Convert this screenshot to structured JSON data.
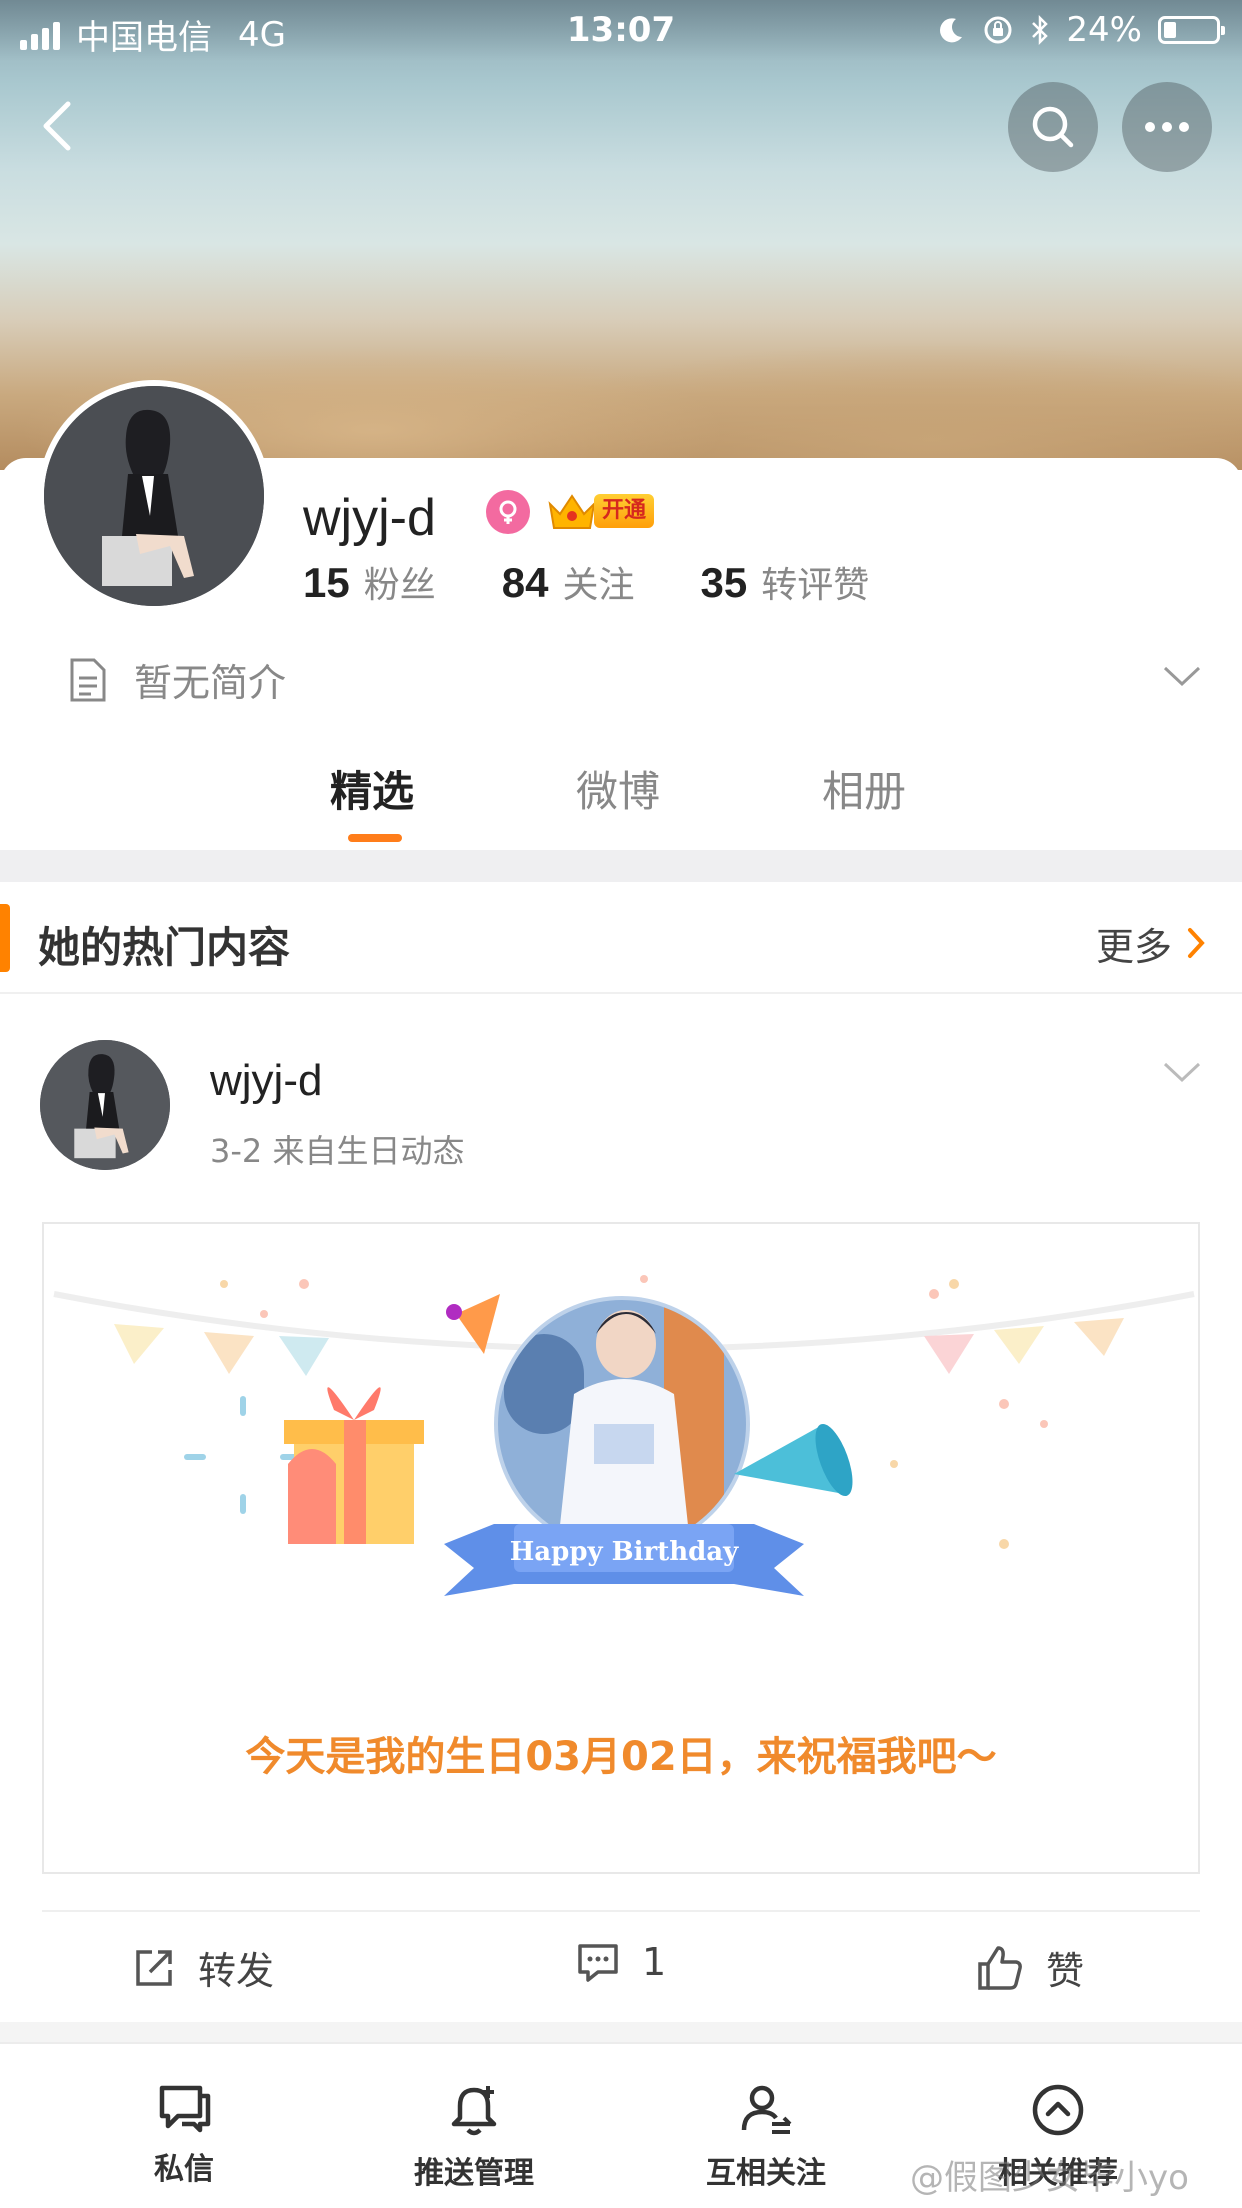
{
  "status_bar": {
    "carrier": "中国电信",
    "network": "4G",
    "time": "13:07",
    "battery": "24%"
  },
  "profile": {
    "username": "wjyj-d",
    "vip_label": "开通",
    "stats": [
      {
        "value": "15",
        "label": "粉丝"
      },
      {
        "value": "84",
        "label": "关注"
      },
      {
        "value": "35",
        "label": "转评赞"
      }
    ],
    "bio": "暂无简介"
  },
  "tabs": [
    {
      "label": "精选",
      "active": true
    },
    {
      "label": "微博",
      "active": false
    },
    {
      "label": "相册",
      "active": false
    }
  ],
  "section": {
    "title": "她的热门内容",
    "more": "更多"
  },
  "post": {
    "author": "wjyj-d",
    "meta": "3-2  来自生日动态",
    "card_banner": "Happy Birthday",
    "card_text": "今天是我的生日03月02日，来祝福我吧～",
    "actions": {
      "repost": "转发",
      "comment_count": "1",
      "like": "赞"
    }
  },
  "bottom_bar": [
    {
      "label": "私信",
      "icon": "message-icon"
    },
    {
      "label": "推送管理",
      "icon": "bell-plus-icon"
    },
    {
      "label": "互相关注",
      "icon": "mutual-follow-icon"
    },
    {
      "label": "相关推荐",
      "icon": "chevron-up-circle-icon"
    }
  ],
  "watermark": "@假图少女毕小yo",
  "colors": {
    "accent": "#ff8200",
    "birthday_text": "#f08a2c",
    "gender_badge": "#f36aa0"
  }
}
